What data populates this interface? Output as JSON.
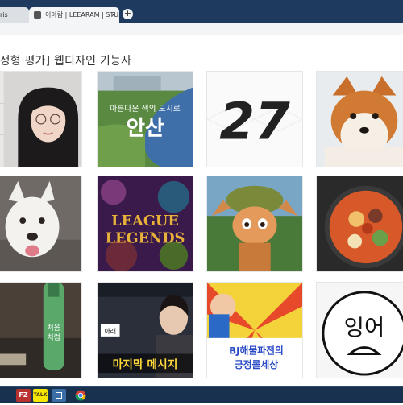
{
  "browser": {
    "tabs": [
      {
        "label": "ris",
        "close": "×"
      },
      {
        "label": "이아람 | LEEARAM | STUDY",
        "close": "×"
      }
    ],
    "new_tab": "+"
  },
  "page": {
    "title": "[정형 평가] 웹디자인 기능사"
  },
  "tiles": [
    {
      "name": "portrait-photo",
      "text": []
    },
    {
      "name": "ansan-poster",
      "text": [
        "아름다운 색의 도시로",
        "안산"
      ]
    },
    {
      "name": "number-27",
      "text": [
        "27"
      ]
    },
    {
      "name": "akita-dog-photo",
      "text": []
    },
    {
      "name": "white-dog-photo",
      "text": []
    },
    {
      "name": "league-of-legends-art",
      "text": [
        "LEAGUE",
        "LEGENDS"
      ]
    },
    {
      "name": "teemo-art",
      "text": []
    },
    {
      "name": "stew-photo",
      "text": []
    },
    {
      "name": "soju-photo",
      "text": [
        "처음",
        "처럼"
      ]
    },
    {
      "name": "youtube-thumbnail",
      "text": [
        "아래",
        "마지막 메시지"
      ]
    },
    {
      "name": "bj-comic",
      "text": [
        "BJ해물파전의",
        "긍정롤세상"
      ]
    },
    {
      "name": "face-drawing",
      "text": [
        "잉어"
      ]
    }
  ],
  "taskbar": {
    "items": [
      {
        "name": "filezilla-icon",
        "label": "FZ",
        "color": "#b8312f"
      },
      {
        "name": "kakaotalk-icon",
        "label": "TALK",
        "color": "#f7e600"
      },
      {
        "name": "app-window-icon",
        "label": "",
        "color": "#3b6ea5"
      },
      {
        "name": "chrome-icon",
        "label": "",
        "color": "#db4437"
      }
    ]
  }
}
